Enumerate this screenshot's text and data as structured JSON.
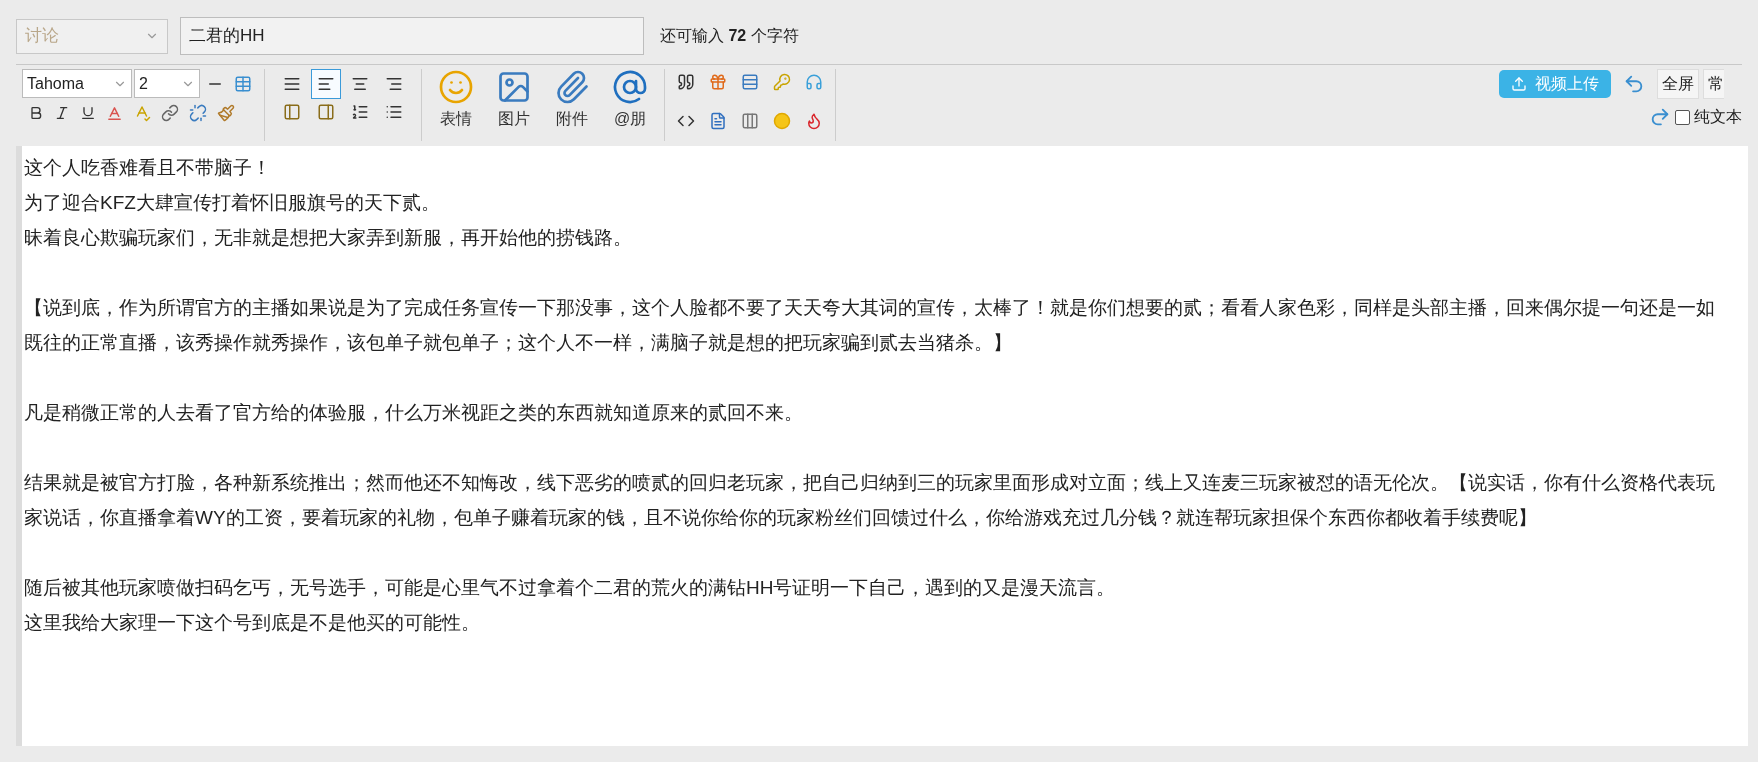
{
  "category_select": {
    "value": "讨论",
    "disabled": true
  },
  "title_field": {
    "value": "二君的HH"
  },
  "char_counter": {
    "prefix": "还可输入",
    "count": "72",
    "suffix": "个字符"
  },
  "toolbar": {
    "font_select": {
      "value": "Tahoma"
    },
    "size_select": {
      "value": "2"
    },
    "alignment": [
      {
        "kind": "justify",
        "selected": false
      },
      {
        "kind": "left",
        "selected": true
      },
      {
        "kind": "center",
        "selected": false
      },
      {
        "kind": "right",
        "selected": false
      }
    ],
    "insert_buttons": [
      {
        "kind": "emoji",
        "label": "表情"
      },
      {
        "kind": "image",
        "label": "图片"
      },
      {
        "kind": "attachment",
        "label": "附件"
      },
      {
        "kind": "mention",
        "label": "@朋"
      }
    ],
    "upload_button": "视频上传",
    "fullscreen_button": "全屏",
    "mode_button": "常",
    "plain_text": {
      "label": "纯文本",
      "checked": false
    }
  },
  "body": {
    "paragraphs": [
      [
        "这个人吃香难看且不带脑子！",
        "为了迎合KFZ大肆宣传打着怀旧服旗号的天下贰。",
        "昧着良心欺骗玩家们，无非就是想把大家弄到新服，再开始他的捞钱路。"
      ],
      [
        "【说到底，作为所谓官方的主播如果说是为了完成任务宣传一下那没事，这个人脸都不要了天天夸大其词的宣传，太棒了！就是你们想要的贰；看看人家色彩，同样是头部主播，回来偶尔提一句还是一如既往的正常直播，该秀操作就秀操作，该包单子就包单子；这个人不一样，满脑子就是想的把玩家骗到贰去当猪杀。】"
      ],
      [
        "凡是稍微正常的人去看了官方给的体验服，什么万米视距之类的东西就知道原来的贰回不来。"
      ],
      [
        "结果就是被官方打脸，各种新系统推出；然而他还不知悔改，线下恶劣的喷贰的回归老玩家，把自己归纳到三的玩家里面形成对立面；线上又连麦三玩家被怼的语无伦次。【说实话，你有什么资格代表玩家说话，你直播拿着WY的工资，要着玩家的礼物，包单子赚着玩家的钱，且不说你给你的玩家粉丝们回馈过什么，你给游戏充过几分钱？就连帮玩家担保个东西你都收着手续费呢】"
      ],
      [
        "随后被其他玩家喷做扫码乞丐，无号选手，可能是心里气不过拿着个二君的荒火的满钻HH号证明一下自己，遇到的又是漫天流言。",
        "这里我给大家理一下这个号到底是不是他买的可能性。"
      ]
    ]
  }
}
